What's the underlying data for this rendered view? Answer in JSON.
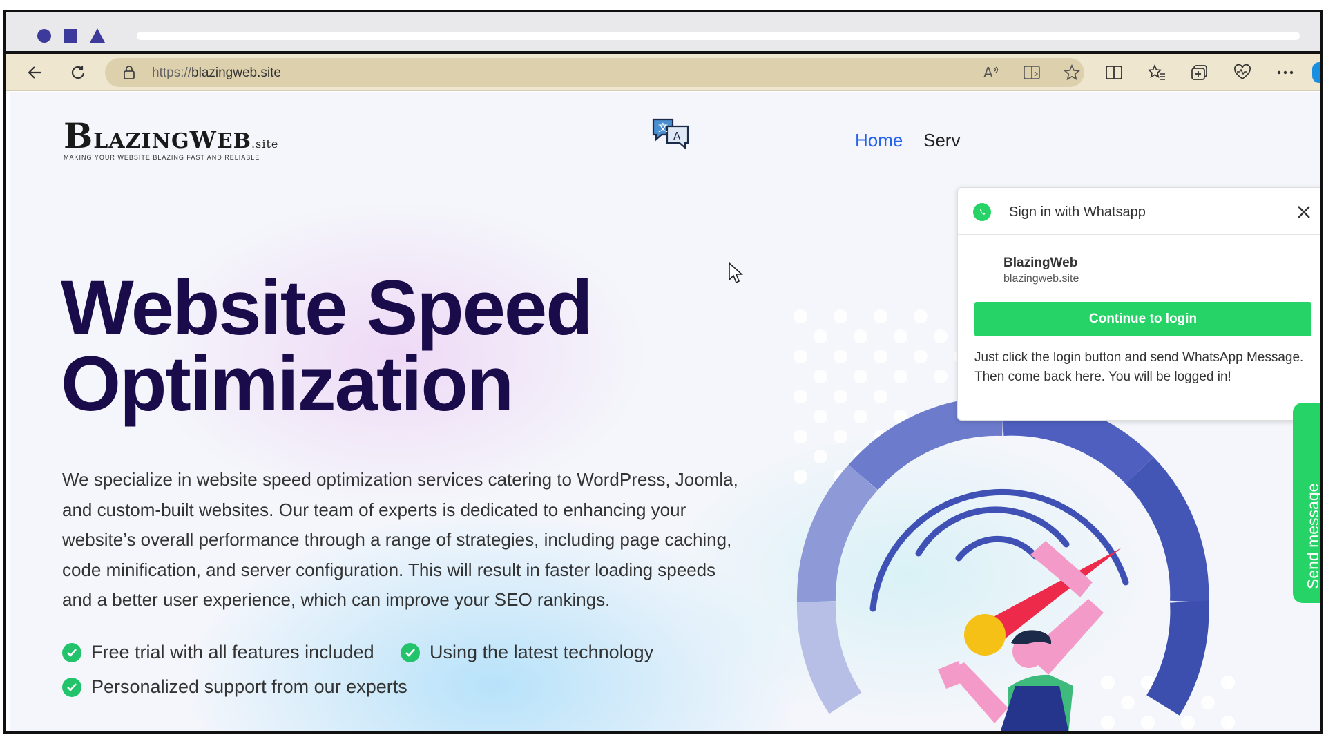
{
  "browser": {
    "url_prefix": "https://",
    "url_domain": "blazingweb.site"
  },
  "site": {
    "logo_text_b": "B",
    "logo_text_mid": "LAZING",
    "logo_text_w": "W",
    "logo_text_eb": "EB",
    "logo_text_site": ".site",
    "logo_tagline": "MAKING YOUR WEBSITE BLAZING FAST AND RELIABLE",
    "nav": {
      "home": "Home",
      "services": "Serv"
    }
  },
  "hero": {
    "title_line1": "Website Speed",
    "title_line2": "Optimization",
    "description": "We specialize in website speed optimization services catering to WordPress, Joomla, and custom-built websites. Our team of experts is dedicated to enhancing your website’s overall performance through a range of strategies, including page caching, code minification, and server configuration. This will result in faster loading speeds and a better user experience, which can improve your SEO rankings.",
    "features": [
      "Free trial with all features included",
      "Using the latest technology",
      "Personalized support from our experts"
    ]
  },
  "whatsapp_popup": {
    "title": "Sign in with Whatsapp",
    "site_name": "BlazingWeb",
    "site_domain": "blazingweb.site",
    "button_label": "Continue to login",
    "note": "Just click the login button and send WhatsApp Message. Then come back here. You will be logged in!"
  },
  "send_tab": {
    "label": "Send message"
  },
  "colors": {
    "accent_blue": "#2563eb",
    "title_navy": "#1a0b4a",
    "whatsapp_green": "#25d366",
    "check_green": "#22c36b",
    "gauge_blue": "#4a5bb8",
    "needle_red": "#ee2a4a"
  }
}
